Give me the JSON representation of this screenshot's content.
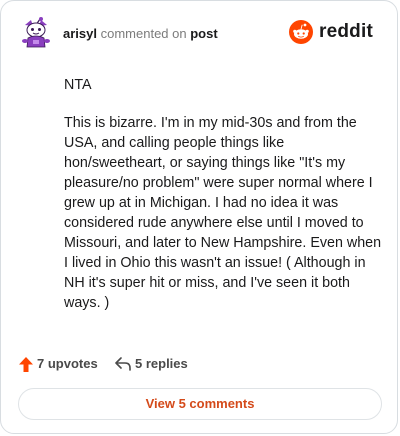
{
  "header": {
    "username": "arisyl",
    "commented_on": "commented on",
    "post_link": "post",
    "brand_word": "reddit",
    "avatar_icon": "snoo-avatar-icon",
    "brand_icon": "reddit-logo-icon"
  },
  "comment": {
    "paragraphs": [
      "NTA",
      "This is bizarre. I'm in my mid-30s and from the USA, and calling people things like hon/sweetheart, or saying things like \"It's my pleasure/no problem\" were super normal where I grew up at in Michigan. I had no idea it was considered rude anywhere else until I moved to Missouri, and later to New Hampshire. Even when I lived in Ohio this wasn't an issue! ( Although in NH it's super hit or miss, and I've seen it both ways. )"
    ]
  },
  "actions": {
    "upvotes_label": "7 upvotes",
    "replies_label": "5 replies",
    "upvote_icon": "upvote-arrow-icon",
    "reply_icon": "reply-arrow-icon"
  },
  "footer": {
    "view_comments_label": "View 5 comments"
  },
  "colors": {
    "accent": "#d44a1a",
    "reddit_orange": "#ff4500",
    "avatar_purple": "#8a3fbf",
    "border": "#d8dde1"
  }
}
